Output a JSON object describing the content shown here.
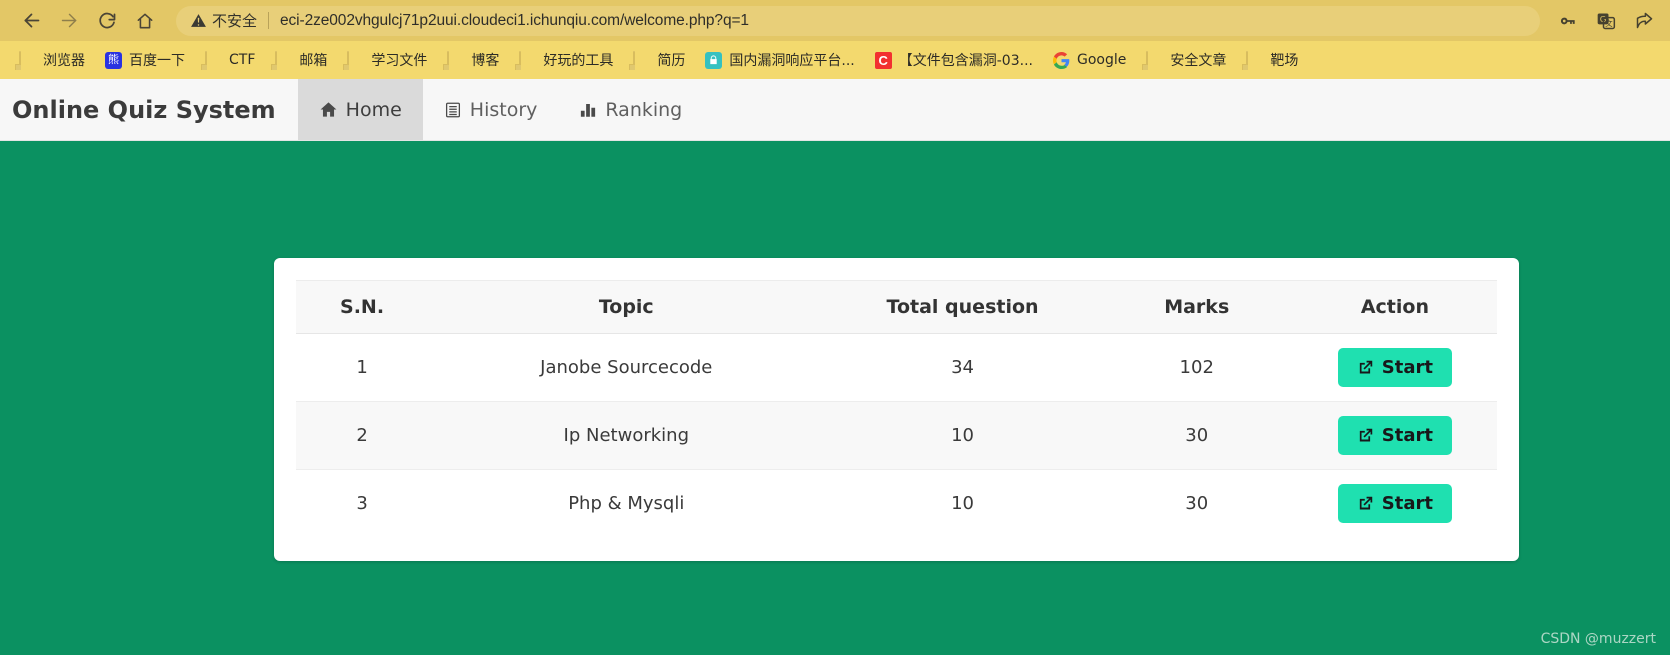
{
  "browser": {
    "nav": {
      "back": "back-arrow",
      "forward": "forward-arrow",
      "reload": "reload",
      "home": "home"
    },
    "omnibox": {
      "security_label": "不安全",
      "url": "eci-2ze002vhgulcj71p2uui.cloudeci1.ichunqiu.com/welcome.php?q=1"
    },
    "toolbar_icons": [
      "key-icon",
      "translate-icon",
      "share-icon"
    ],
    "bookmarks": [
      {
        "label": "浏览器",
        "icon": "doc"
      },
      {
        "label": "百度一下",
        "icon": "baidu"
      },
      {
        "label": "CTF",
        "icon": "doc"
      },
      {
        "label": "邮箱",
        "icon": "doc"
      },
      {
        "label": "学习文件",
        "icon": "doc"
      },
      {
        "label": "博客",
        "icon": "doc"
      },
      {
        "label": "好玩的工具",
        "icon": "doc"
      },
      {
        "label": "简历",
        "icon": "doc"
      },
      {
        "label": "国内漏洞响应平台...",
        "icon": "green-lock"
      },
      {
        "label": "【文件包含漏洞-03...",
        "icon": "csdn"
      },
      {
        "label": "Google",
        "icon": "google"
      },
      {
        "label": "安全文章",
        "icon": "doc"
      },
      {
        "label": "靶场",
        "icon": "doc"
      }
    ]
  },
  "app": {
    "brand": "Online Quiz System",
    "tabs": [
      {
        "label": "Home",
        "icon": "home-icon",
        "active": true
      },
      {
        "label": "History",
        "icon": "history-icon",
        "active": false
      },
      {
        "label": "Ranking",
        "icon": "ranking-icon",
        "active": false
      }
    ],
    "table": {
      "columns": [
        "S.N.",
        "Topic",
        "Total question",
        "Marks",
        "Action"
      ],
      "rows": [
        {
          "sn": "1",
          "topic": "Janobe Sourcecode",
          "total": "34",
          "marks": "102",
          "action": "Start"
        },
        {
          "sn": "2",
          "topic": "Ip Networking",
          "total": "10",
          "marks": "30",
          "action": "Start"
        },
        {
          "sn": "3",
          "topic": "Php & Mysqli",
          "total": "10",
          "marks": "30",
          "action": "Start"
        }
      ]
    }
  },
  "colors": {
    "page_background": "#0b9161",
    "toolbar_background": "#e3c766",
    "bookmarks_background": "#f3d96e",
    "start_button": "#1fe0b0",
    "active_tab": "#dadada"
  },
  "watermark": "CSDN @muzzert"
}
